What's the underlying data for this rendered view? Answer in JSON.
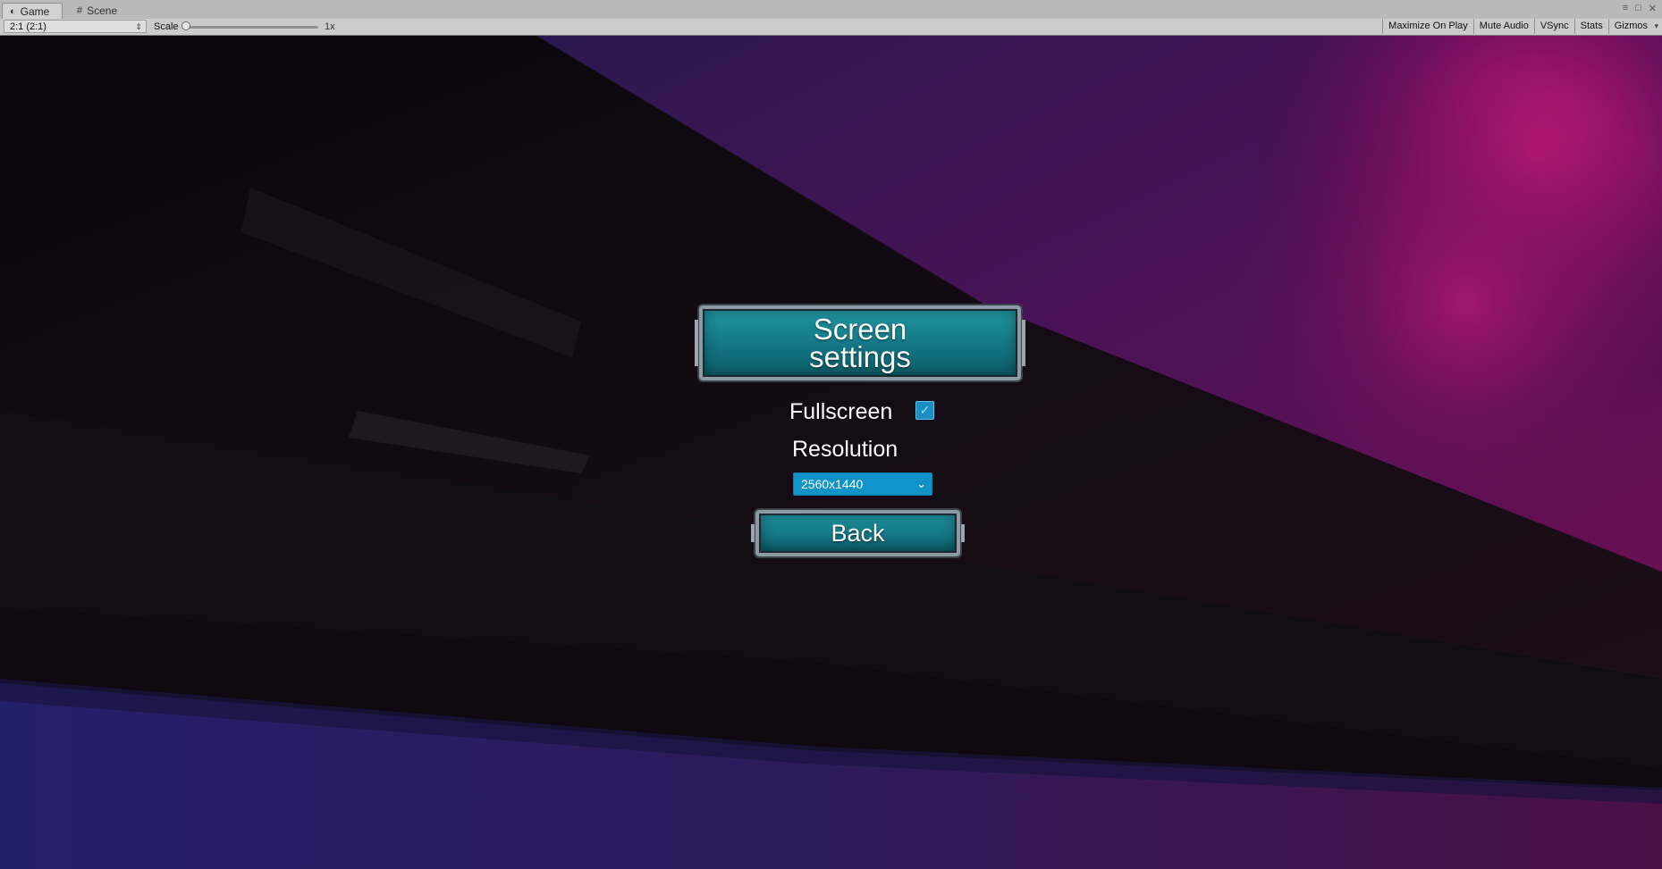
{
  "editor": {
    "tabs": [
      {
        "label": "Game",
        "icon": "game-icon",
        "active": true
      },
      {
        "label": "Scene",
        "icon": "grid-icon",
        "active": false
      }
    ],
    "toolbar": {
      "aspect": "2:1 (2:1)",
      "scale_label": "Scale",
      "scale_value": "1x",
      "buttons": [
        "Maximize On Play",
        "Mute Audio",
        "VSync",
        "Stats",
        "Gizmos"
      ]
    }
  },
  "game": {
    "title": "Screen settings",
    "fullscreen_label": "Fullscreen",
    "fullscreen_checked": true,
    "resolution_label": "Resolution",
    "resolution_value": "2560x1440",
    "back_label": "Back",
    "colors": {
      "button": "#137683",
      "dropdown": "#0f93c8",
      "background_purple": "#6a1052",
      "background_blue": "#2a1f6e"
    }
  }
}
